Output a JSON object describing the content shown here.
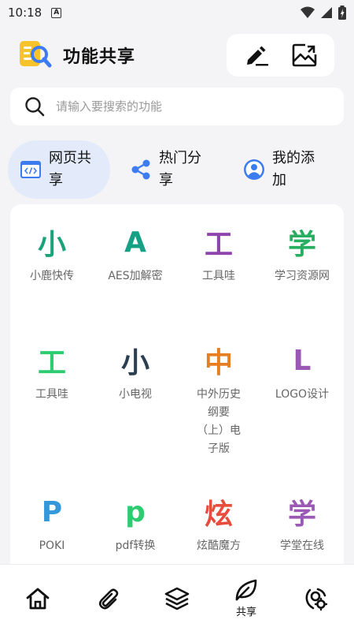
{
  "status_bar": {
    "time": "10:18",
    "notification_letter": "A"
  },
  "header": {
    "title": "功能共享"
  },
  "search": {
    "placeholder": "请输入要搜索的功能"
  },
  "tabs": [
    {
      "label": "网页共享",
      "active": true
    },
    {
      "label": "热门分享",
      "active": false
    },
    {
      "label": "我的添加",
      "active": false
    }
  ],
  "grid": [
    {
      "glyph": "小",
      "label": "小鹿快传",
      "color": "#1aa37a"
    },
    {
      "glyph": "A",
      "label": "AES加解密",
      "color": "#16a085"
    },
    {
      "glyph": "工",
      "label": "工具哇",
      "color": "#8e44ad"
    },
    {
      "glyph": "学",
      "label": "学习资源网",
      "color": "#27ae60"
    },
    {
      "glyph": "工",
      "label": "工具哇",
      "color": "#2ecc71"
    },
    {
      "glyph": "小",
      "label": "小电视",
      "color": "#2c3e50"
    },
    {
      "glyph": "中",
      "label": "中外历史纲要（上）电子版",
      "color": "#e67e22"
    },
    {
      "glyph": "L",
      "label": "LOGO设计",
      "color": "#9b59b6"
    },
    {
      "glyph": "P",
      "label": "POKI",
      "color": "#3498db"
    },
    {
      "glyph": "p",
      "label": "pdf转换",
      "color": "#2ecc71"
    },
    {
      "glyph": "炫",
      "label": "炫酷魔方",
      "color": "#e74c3c"
    },
    {
      "glyph": "学",
      "label": "学堂在线",
      "color": "#9b59b6"
    }
  ],
  "bottom_nav": {
    "active_label": "共享",
    "items": [
      {
        "icon": "home-icon"
      },
      {
        "icon": "paperclip-icon"
      },
      {
        "icon": "layers-icon"
      },
      {
        "icon": "leaf-icon",
        "label": "共享"
      },
      {
        "icon": "person-settings-icon"
      }
    ]
  },
  "colors": {
    "accent": "#3d7cf0",
    "active_tab_bg": "#e3ebfb",
    "logo_yellow": "#f6c32b"
  }
}
